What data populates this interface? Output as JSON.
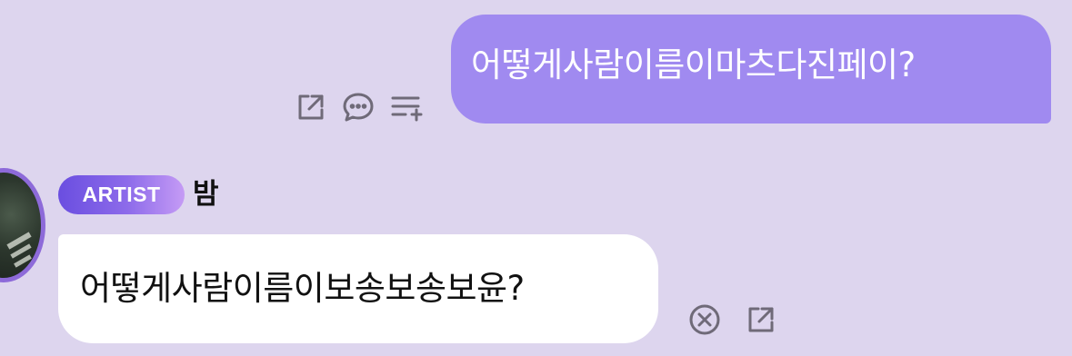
{
  "messages": {
    "outgoing": {
      "text": "어떻게사람이름이마츠다진페이?",
      "actions": [
        "share-icon",
        "comment-icon",
        "add-to-list-icon"
      ]
    },
    "incoming": {
      "badge": "ARTIST",
      "sender": "밤",
      "text": "어떻게사람이름이보송보송보윤?",
      "actions": [
        "close-circle-icon",
        "share-icon"
      ]
    }
  },
  "colors": {
    "background": "#ddd5ee",
    "outgoing_bubble": "#a08af0",
    "incoming_bubble": "#ffffff",
    "badge_gradient_start": "#6a4ee0",
    "badge_gradient_end": "#c59bf5",
    "icon": "#6f6a78"
  }
}
